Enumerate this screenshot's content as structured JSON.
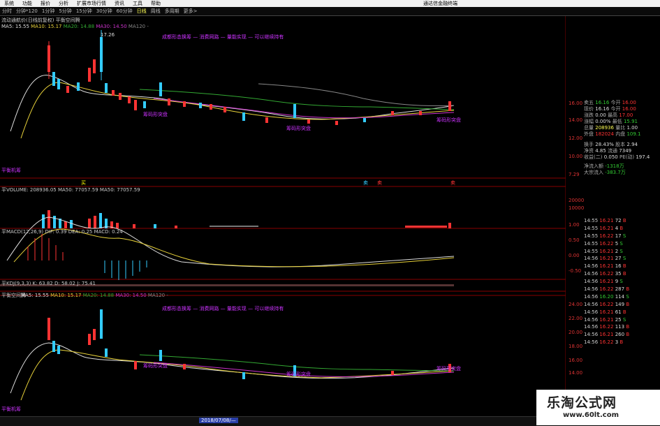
{
  "menubar": {
    "items": [
      "系统",
      "功能",
      "报价",
      "分析",
      "扩展市场行情",
      "资讯",
      "工具",
      "帮助"
    ],
    "app_title": "通达信金融终端"
  },
  "periods": [
    "分时",
    "分钟*120",
    "1分钟",
    "5分钟",
    "15分钟",
    "30分钟",
    "60分钟",
    "日线",
    "周线",
    "多周期",
    "更多>"
  ],
  "main_panel": {
    "title": "流动通航价(日线前复权)  平衡空间腾",
    "ma5": "MA5: 15.55",
    "ma10": "MA10: 15.17",
    "ma20": "MA20: 14.88",
    "ma30": "MA30: 14.50",
    "ma120": "MA120 -",
    "notes": "成都形态换筹 — 消费网路 — 量能实现 — 可以继续持有",
    "high_label": "17.26",
    "low_label": "平衡机筹",
    "tags": [
      "筹码形突盘",
      "筹码形突盘",
      "筹码形突盘",
      "平衡机筹"
    ]
  },
  "volume_panel": {
    "label": "平VOLUME: 208936.05  MA50: 77057.59  MA50: 77057.59",
    "marks": [
      "买",
      "卖",
      "卖",
      "卖"
    ]
  },
  "macd_panel": {
    "label": "平MACD(12,26,9)  DIF: 0.39  DEA: 0.25  MACD: 0.24"
  },
  "kdj_panel": {
    "label": "平KDJ(9,3,3)  K: 63.82  D: 58.02  J: 75.41"
  },
  "lower_panel": {
    "title": "平衡空间腾",
    "ma5": "MA5: 15.55",
    "ma10": "MA10: 15.17",
    "ma20": "MA20: 14.88",
    "ma30": "MA30: 14.50",
    "ma120": "MA120 -",
    "notes": "成都形态换筹 — 消费网路 — 量能实现 — 可以继续持有",
    "tags": [
      "筹码形突盘",
      "筹码形突盘",
      "筹码形突盘",
      "平衡机筹"
    ]
  },
  "date_badge": "2018/07/08/—",
  "right_axis": {
    "main": [
      "16.00",
      "14.00",
      "12.00",
      "10.00",
      "7.29"
    ],
    "volume": [
      "20000",
      "10000"
    ],
    "macd": [
      "1.00",
      "0.50",
      "0.00",
      "-0.50"
    ],
    "lower": [
      "24.00",
      "22.00",
      "20.00",
      "18.00",
      "16.00",
      "14.00"
    ]
  },
  "quote": {
    "rows": [
      [
        "卖五",
        "16.16",
        "今开",
        "16.00"
      ],
      [
        "现价",
        "16.16",
        "今开",
        "16.00"
      ],
      [
        "涨跌",
        "0.00",
        "最高",
        "17.00"
      ],
      [
        "涨幅",
        "0.00%",
        "最低",
        "15.91"
      ],
      [
        "总量",
        "208936",
        "量比",
        "1.00"
      ],
      [
        "外盘",
        "182024",
        "内盘",
        "109.1"
      ],
      [
        "换手",
        "28.43%",
        "股本",
        "2.94"
      ],
      [
        "净资",
        "4.85",
        "流通",
        "7349"
      ],
      [
        "收益(二)",
        "0.050",
        "PE(动)",
        "197.4"
      ]
    ],
    "flow": [
      [
        "净流入额",
        "-1318万"
      ],
      [
        "大宗流入",
        "-383.7万"
      ]
    ]
  },
  "ticks": [
    [
      "14:55",
      "16.21",
      "72",
      "B"
    ],
    [
      "14:55",
      "16.21",
      "4",
      "B"
    ],
    [
      "14:55",
      "16.22",
      "17",
      "S"
    ],
    [
      "14:55",
      "16.22",
      "5",
      "S"
    ],
    [
      "14:55",
      "16.21",
      "2",
      "S"
    ],
    [
      "14:56",
      "16.21",
      "27",
      "S"
    ],
    [
      "14:56",
      "16.21",
      "16",
      "B"
    ],
    [
      "14:56",
      "16.22",
      "35",
      "B"
    ],
    [
      "14:56",
      "16.21",
      "9",
      "S"
    ],
    [
      "14:56",
      "16.22",
      "287",
      "B"
    ],
    [
      "14:56",
      "16.20",
      "114",
      "S"
    ],
    [
      "14:56",
      "16.22",
      "149",
      "B"
    ],
    [
      "14:56",
      "16.21",
      "61",
      "B"
    ],
    [
      "14:56",
      "16.21",
      "25",
      "S"
    ],
    [
      "14:56",
      "16.22",
      "113",
      "B"
    ],
    [
      "14:56",
      "16.21",
      "260",
      "B"
    ],
    [
      "14:56",
      "16.22",
      "3",
      "B"
    ]
  ],
  "watermark": {
    "line1": "乐淘公式网",
    "line2": "www.60lt.com"
  },
  "status": "2018/07/08/—"
}
